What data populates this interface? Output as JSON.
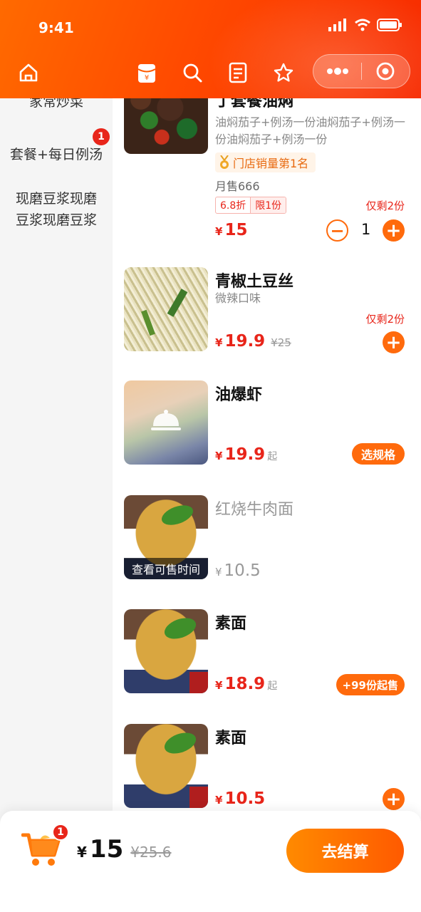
{
  "status_bar": {
    "time": "9:41"
  },
  "colors": {
    "accent": "#ff6a0c",
    "price_red": "#e8251a",
    "header_start": "#ff6a00",
    "header_end": "#f72a00"
  },
  "nav": {
    "icons": [
      "home-icon",
      "red-envelope-icon",
      "search-icon",
      "order-list-icon",
      "star-icon",
      "more-icon",
      "record-icon"
    ]
  },
  "sidebar": {
    "categories": [
      {
        "label": "家常炒菜"
      },
      {
        "label": "套餐+每日例汤",
        "badge": "1"
      },
      {
        "label": "现磨豆浆现磨豆浆现磨豆浆"
      }
    ]
  },
  "items": [
    {
      "title": "丁套餐油焖",
      "desc": "油焖茄子+例汤一份油焖茄子+例汤一份油焖茄子+例汤一份",
      "rank_tag": "门店销量第1名",
      "monthly": "月售666",
      "discount": "6.8折",
      "limit": "限1份",
      "stock": "仅剩2份",
      "currency": "¥",
      "price": "15",
      "quantity": "1"
    },
    {
      "title": "青椒土豆丝",
      "desc": "微辣口味",
      "stock": "仅剩2份",
      "currency": "¥",
      "price": "19.9",
      "orig_price": "¥25"
    },
    {
      "title": "油爆虾",
      "currency": "¥",
      "price": "19.9",
      "suffix": "起",
      "button": "选规格"
    },
    {
      "title": "红烧牛肉面",
      "currency": "¥",
      "price": "10.5",
      "overlay": "查看可售时间"
    },
    {
      "title": "素面",
      "currency": "¥",
      "price": "18.9",
      "suffix": "起",
      "button": "+99份起售"
    },
    {
      "title": "素面",
      "currency": "¥",
      "price": "10.5"
    }
  ],
  "cart": {
    "badge": "1",
    "currency": "¥",
    "total": "15",
    "orig_total": "¥25.6",
    "checkout_label": "去结算"
  }
}
